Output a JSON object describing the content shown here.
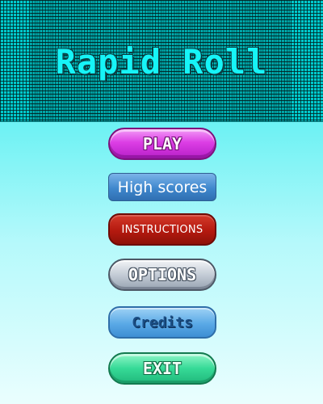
{
  "game": {
    "title": "Rapid Roll"
  },
  "menu": {
    "play_label": "PLAY",
    "high_scores_label": "High scores",
    "instructions_label": "INSTRUCTIONS",
    "options_label": "OPTIONS",
    "credits_label": "Credits",
    "exit_label": "EXIT"
  },
  "colors": {
    "background_top": "#22e6ea",
    "background_bottom": "#eafefe",
    "title": "#16f4f7",
    "play": "#dc3ee5",
    "high_scores": "#3f87cd",
    "instructions": "#b4190f",
    "options": "#c4ccd6",
    "credits": "#5aa9e6",
    "exit": "#36da97"
  }
}
